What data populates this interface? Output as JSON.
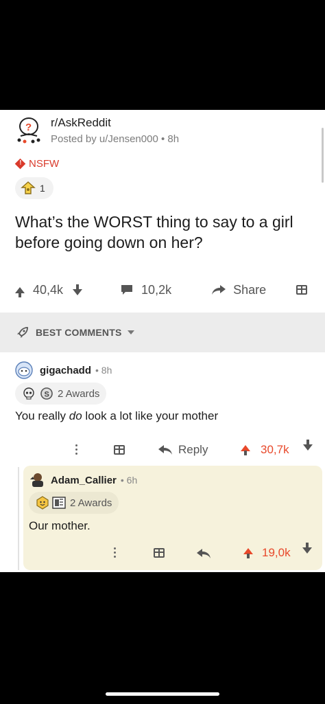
{
  "post": {
    "subreddit": "r/AskReddit",
    "posted_by": "Posted by u/Jensen000 • 8h",
    "nsfw_label": "NSFW",
    "award_count": "1",
    "title": "What’s the WORST thing to say to a girl before going down on her?",
    "score": "40,4k",
    "comments": "10,2k",
    "share_label": "Share"
  },
  "sort": {
    "label": "BEST COMMENTS"
  },
  "comments": [
    {
      "user": "gigachadd",
      "time": "• 8h",
      "awards": "2 Awards",
      "body_prefix": "You really ",
      "body_emphasis": "do",
      "body_suffix": " look a lot like your mother",
      "reply_label": "Reply",
      "score": "30,7k"
    },
    {
      "user": "Adam_Callier",
      "time": "• 6h",
      "awards": "2 Awards",
      "body": "Our mother.",
      "score": "19,0k"
    }
  ],
  "colors": {
    "accent": "#e8492b",
    "nsfw": "#d93a2b",
    "reply_bg": "#f6f2dc",
    "sort_bg": "#ececec"
  }
}
